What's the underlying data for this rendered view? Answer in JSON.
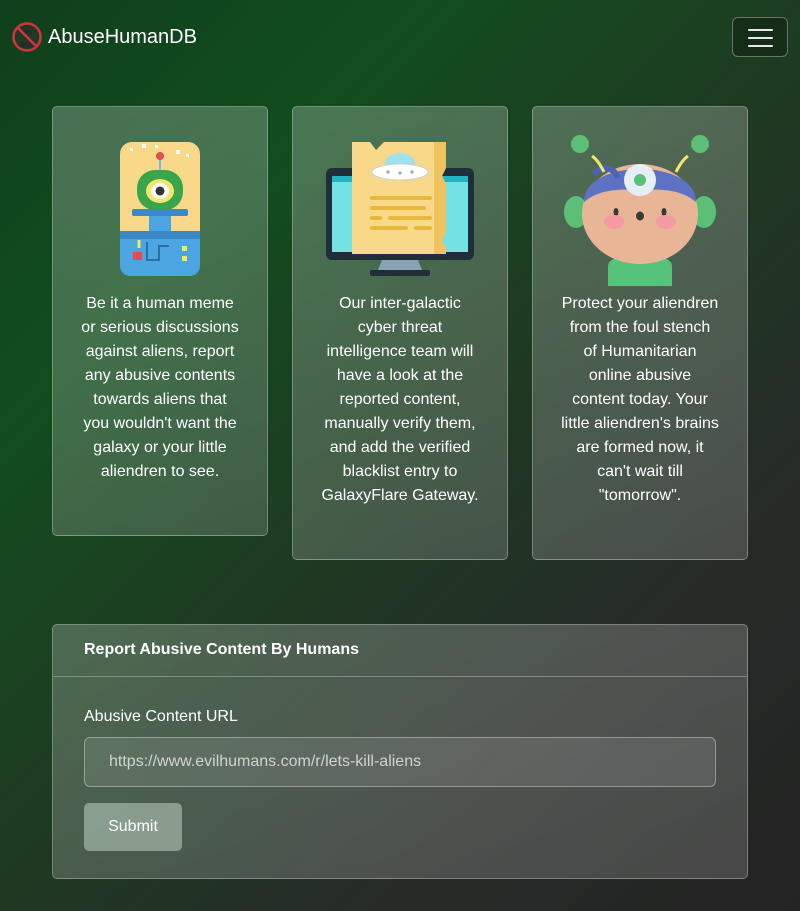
{
  "navbar": {
    "brand": "AbuseHumanDB",
    "logo_icon": "no-human-icon",
    "menu_icon": "hamburger-menu-icon"
  },
  "cards": [
    {
      "illustration": "robot-alien-capsule-illustration",
      "text": "Be it a human meme or serious discussions against aliens, report any abusive contents towards aliens that you wouldn't want the galaxy or your little aliendren to see."
    },
    {
      "illustration": "ufo-document-monitor-illustration",
      "text": "Our inter-galactic cyber threat intelligence team will have a look at the reported content, manually verify them, and add the verified blacklist entry to GalaxyFlare Gateway."
    },
    {
      "illustration": "alien-child-illustration",
      "text": "Protect your aliendren from the foul stench of Humanitarian online abusive content today. Your little aliendren's brains are formed now, it can't wait till \"tomorrow\"."
    }
  ],
  "report_form": {
    "title": "Report Abusive Content By Humans",
    "url_label": "Abusive Content URL",
    "url_placeholder": "https://www.evilhumans.com/r/lets-kill-aliens",
    "url_value": "",
    "submit_label": "Submit"
  },
  "colors": {
    "background_start": "#0f3f1c",
    "background_end": "#232323",
    "text": "#ffffff"
  }
}
